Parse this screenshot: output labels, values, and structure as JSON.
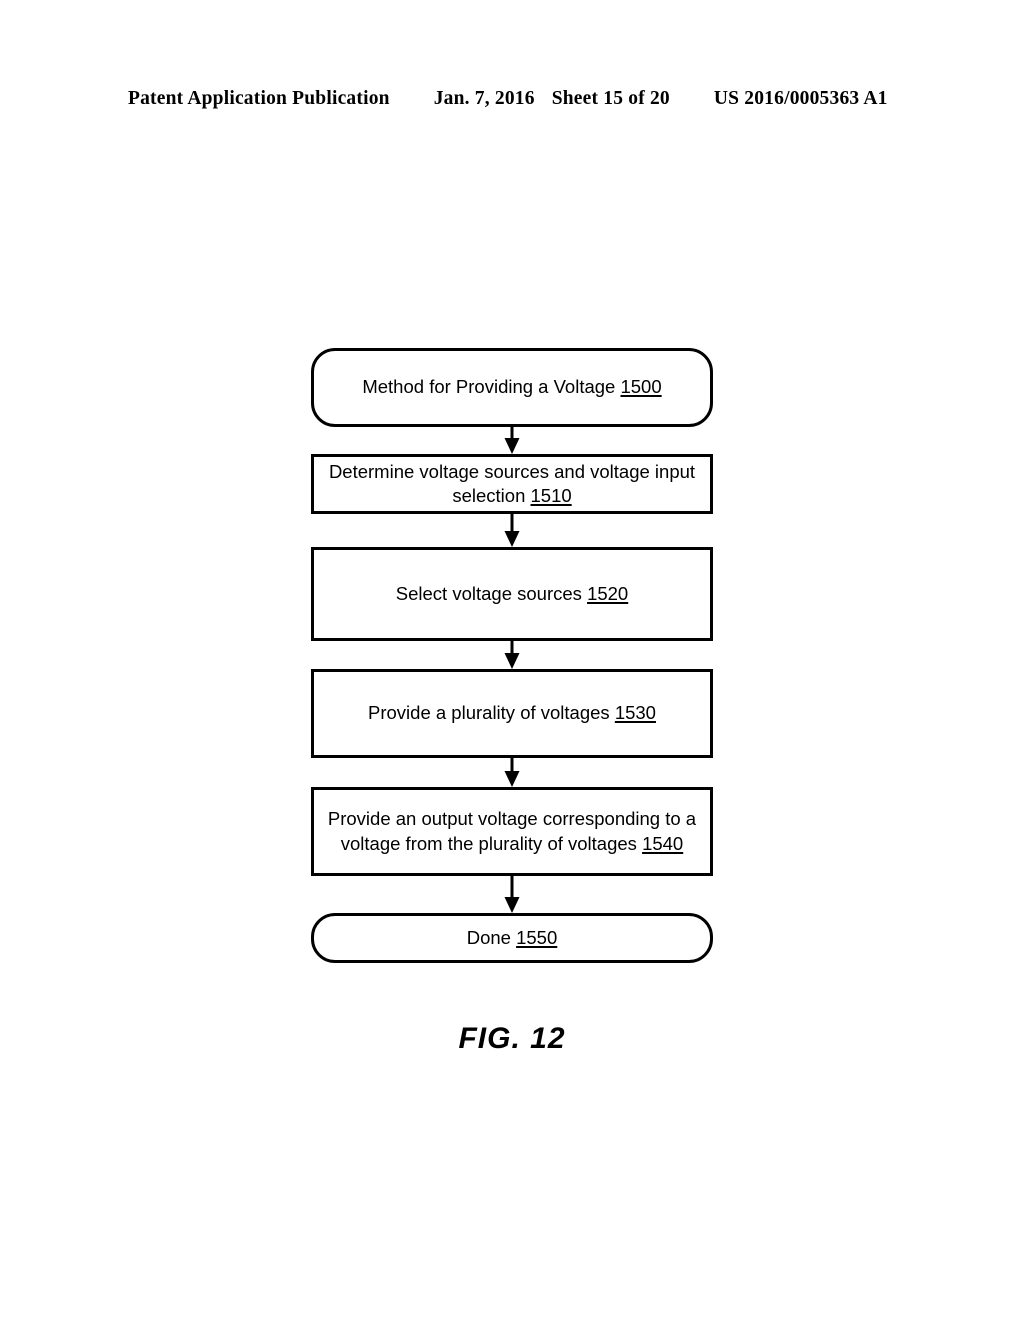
{
  "header": {
    "publication": "Patent Application Publication",
    "date": "Jan. 7, 2016",
    "sheet": "Sheet 15 of 20",
    "doc_number": "US 2016/0005363 A1"
  },
  "figure": {
    "caption": "FIG. 12"
  },
  "flowchart": {
    "nodes": [
      {
        "id": "method-start",
        "shape": "terminal",
        "text": "Method for Providing a Voltage",
        "ref": "1500",
        "lines": [
          "Method for Providing a Voltage 1500"
        ]
      },
      {
        "id": "determine-sources",
        "shape": "process",
        "text": "Determine voltage sources and voltage input selection",
        "ref": "1510",
        "lines": [
          "Determine voltage sources and voltage",
          "input selection 1510"
        ]
      },
      {
        "id": "select-sources",
        "shape": "process",
        "text": "Select voltage sources",
        "ref": "1520",
        "lines": [
          "Select voltage sources 1520"
        ]
      },
      {
        "id": "provide-plurality",
        "shape": "process",
        "text": "Provide a plurality of voltages",
        "ref": "1530",
        "lines": [
          "Provide a plurality of voltages 1530"
        ]
      },
      {
        "id": "provide-output",
        "shape": "process",
        "text": "Provide an output voltage corresponding to a voltage from the plurality of voltages",
        "ref": "1540",
        "lines": [
          "Provide an output voltage corresponding to",
          "a voltage from the plurality of voltages 1540"
        ]
      },
      {
        "id": "done",
        "shape": "terminal",
        "text": "Done",
        "ref": "1550",
        "lines": [
          "Done 1550"
        ]
      }
    ],
    "connectors": [
      {
        "from": "method-start",
        "to": "determine-sources",
        "type": "arrow-down"
      },
      {
        "from": "determine-sources",
        "to": "select-sources",
        "type": "arrow-down"
      },
      {
        "from": "select-sources",
        "to": "provide-plurality",
        "type": "arrow-down"
      },
      {
        "from": "provide-plurality",
        "to": "provide-output",
        "type": "arrow-down"
      },
      {
        "from": "provide-output",
        "to": "done",
        "type": "arrow-down"
      }
    ],
    "stroke_color": "#000000",
    "fill_color": "#ffffff"
  }
}
